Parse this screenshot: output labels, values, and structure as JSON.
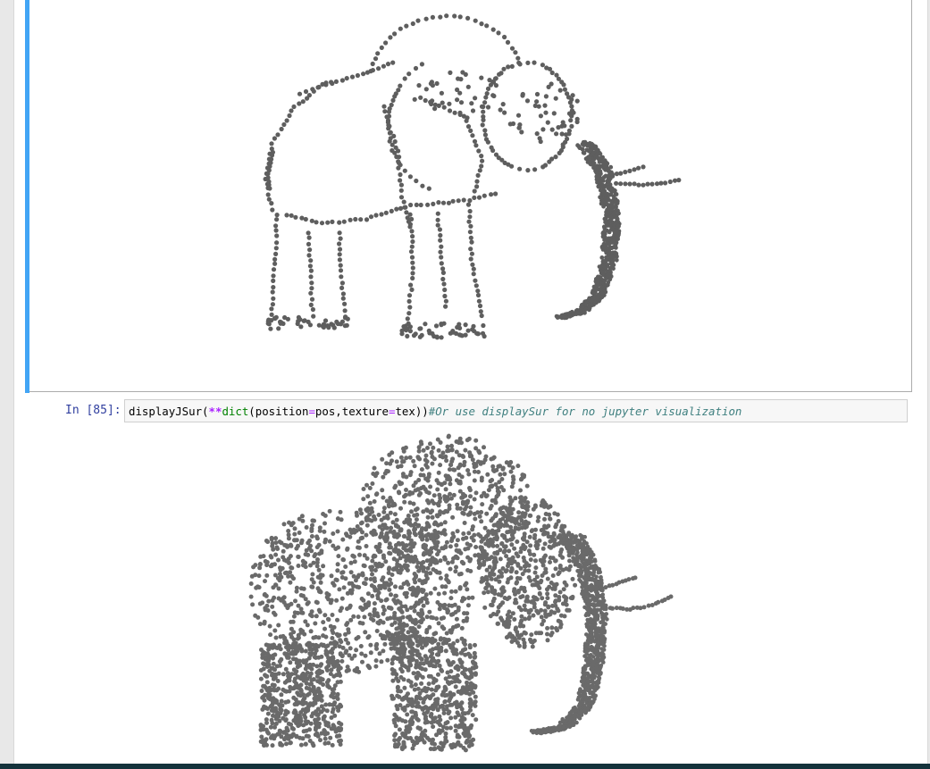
{
  "cell": {
    "prompt": "In [85]:",
    "code": {
      "fn": "displayJSur(",
      "op": "**",
      "builtin": "dict",
      "p1": "(position",
      "eq1": "=",
      "p2": "pos,texture",
      "eq2": "=",
      "p3": "tex))",
      "comment": "#Or use displaySur for no jupyter visualization"
    }
  },
  "outputs": [
    {
      "name": "elephant-point-cloud-sparse",
      "point_color": "#5e5e5e"
    },
    {
      "name": "elephant-point-cloud-dense",
      "point_color": "#6a6a6a"
    }
  ],
  "colors": {
    "selected_border": "#42a5f5",
    "prompt": "#303f9f",
    "comment": "#408080",
    "operator": "#aa22ff",
    "builtin": "#008000",
    "taskbar": "#14323b"
  }
}
